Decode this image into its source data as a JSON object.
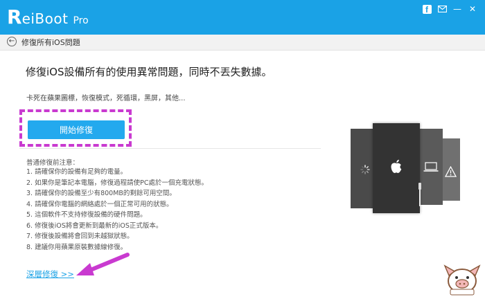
{
  "app": {
    "logo_initial": "R",
    "logo_word": "eiBoot",
    "logo_suffix": "Pro"
  },
  "window_controls": {
    "facebook_glyph": "f",
    "minimize_glyph": "—",
    "close_glyph": "✕"
  },
  "breadcrumb": {
    "back_glyph": "←",
    "title": "修復所有iOS問題"
  },
  "main": {
    "headline": "修復iOS設備所有的使用異常問題，同時不丟失數據。",
    "symptoms": "卡死在蘋果圖標，恢復模式，死循環，黑屏，其他...",
    "start_button": "開始修復",
    "notes_title": "普通修復前注意：",
    "notes": [
      "1. 請確保你的設備有足夠的電量。",
      "2. 如果你是筆記本電腦，修復過程請使PC處於一個充電狀態。",
      "3. 請確保你的設備至少有800MB的剩餘可用空間。",
      "4. 請確保你電腦的網絡處於一個正常可用的狀態。",
      "5. 這個軟件不支持修復設備的硬件問題。",
      "6. 修復後iOS將會更新到最新的iOS正式版本。",
      "7. 修復後設備將會回到未越獄狀態。",
      "8. 建議你用蘋果原裝數據線修復。"
    ],
    "deep_repair_link": "深層修復 >>"
  },
  "colors": {
    "titlebar": "#1aa2e6",
    "button": "#23a9ee",
    "highlight_frame": "#c93ad0",
    "arrow": "#c93ad0"
  },
  "icons": [
    "facebook-icon",
    "mail-icon",
    "minimize-icon",
    "close-icon",
    "back-arrow-icon",
    "apple-icon",
    "spinner-icon",
    "laptop-icon",
    "warning-icon",
    "cable-icon",
    "mascot-watermark"
  ]
}
